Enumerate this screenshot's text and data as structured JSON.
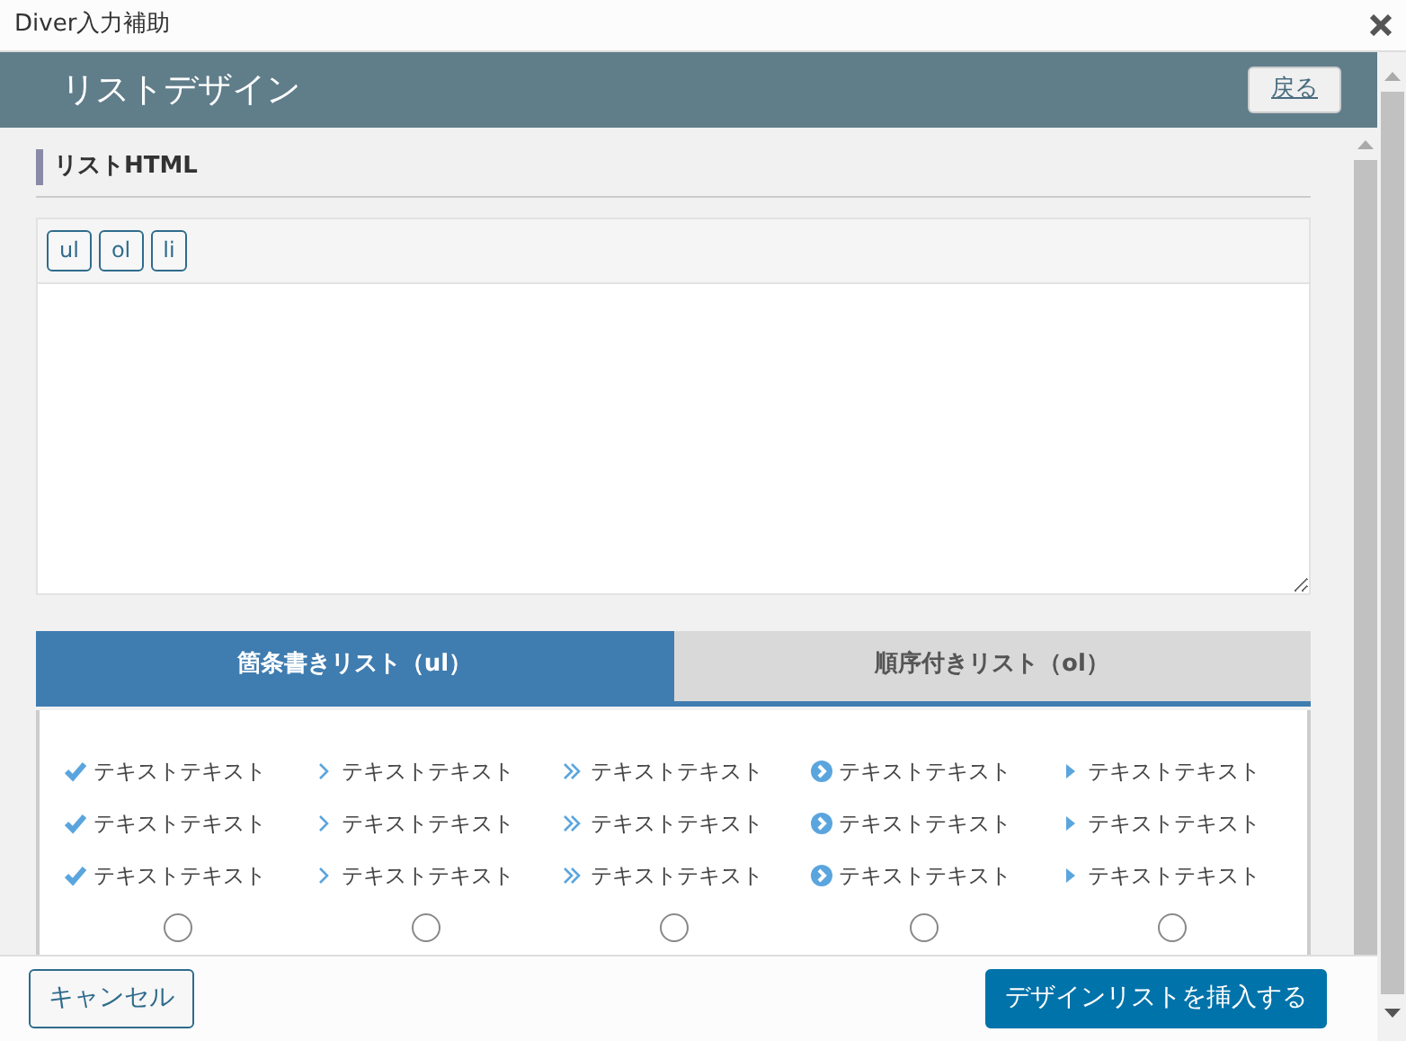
{
  "window": {
    "title": "Diver入力補助"
  },
  "header": {
    "title": "リストデザイン",
    "back_button": "戻る"
  },
  "section": {
    "heading": "リストHTML"
  },
  "editor": {
    "buttons": [
      "ul",
      "ol",
      "li"
    ]
  },
  "tabs": [
    {
      "label": "箇条書きリスト（ul）",
      "selected": true
    },
    {
      "label": "順序付きリスト（ol）",
      "selected": false
    }
  ],
  "designs": [
    {
      "kind": "check",
      "items": [
        "テキストテキスト",
        "テキストテキスト",
        "テキストテキスト"
      ],
      "selected": false
    },
    {
      "kind": "chevron",
      "items": [
        "テキストテキスト",
        "テキストテキスト",
        "テキストテキスト"
      ],
      "selected": false
    },
    {
      "kind": "double-chevron",
      "items": [
        "テキストテキスト",
        "テキストテキスト",
        "テキストテキスト"
      ],
      "selected": false
    },
    {
      "kind": "circle-chevron",
      "items": [
        "テキストテキスト",
        "テキストテキスト",
        "テキストテキスト"
      ],
      "selected": false
    },
    {
      "kind": "triangle",
      "items": [
        "テキストテキスト",
        "テキストテキスト",
        "テキストテキスト"
      ],
      "selected": false
    }
  ],
  "footer": {
    "cancel": "キャンセル",
    "insert": "デザインリストを挿入する"
  }
}
